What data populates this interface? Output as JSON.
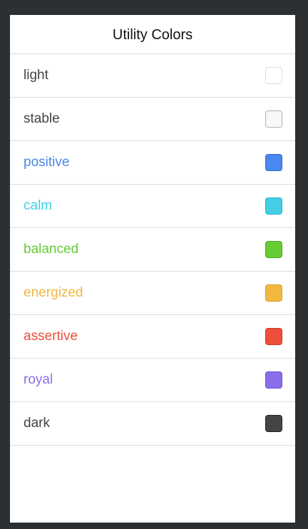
{
  "header": {
    "title": "Utility Colors"
  },
  "colors": [
    {
      "label": "light",
      "text_color": "#444444",
      "swatch_color": "#ffffff",
      "border_color": "#dddddd"
    },
    {
      "label": "stable",
      "text_color": "#444444",
      "swatch_color": "#f8f8f8",
      "border_color": "#b2b2b2"
    },
    {
      "label": "positive",
      "text_color": "#4a87ee",
      "swatch_color": "#4a87ee",
      "border_color": "#2a6fdc"
    },
    {
      "label": "calm",
      "text_color": "#43cee6",
      "swatch_color": "#43cee6",
      "border_color": "#1fb6d1"
    },
    {
      "label": "balanced",
      "text_color": "#66cc33",
      "swatch_color": "#66cc33",
      "border_color": "#4fa628"
    },
    {
      "label": "energized",
      "text_color": "#f0b840",
      "swatch_color": "#f0b840",
      "border_color": "#d69e20"
    },
    {
      "label": "assertive",
      "text_color": "#ef4e3a",
      "swatch_color": "#ef4e3a",
      "border_color": "#c83a28"
    },
    {
      "label": "royal",
      "text_color": "#8a6de9",
      "swatch_color": "#8a6de9",
      "border_color": "#6a4fd0"
    },
    {
      "label": "dark",
      "text_color": "#444444",
      "swatch_color": "#444444",
      "border_color": "#222222"
    }
  ]
}
